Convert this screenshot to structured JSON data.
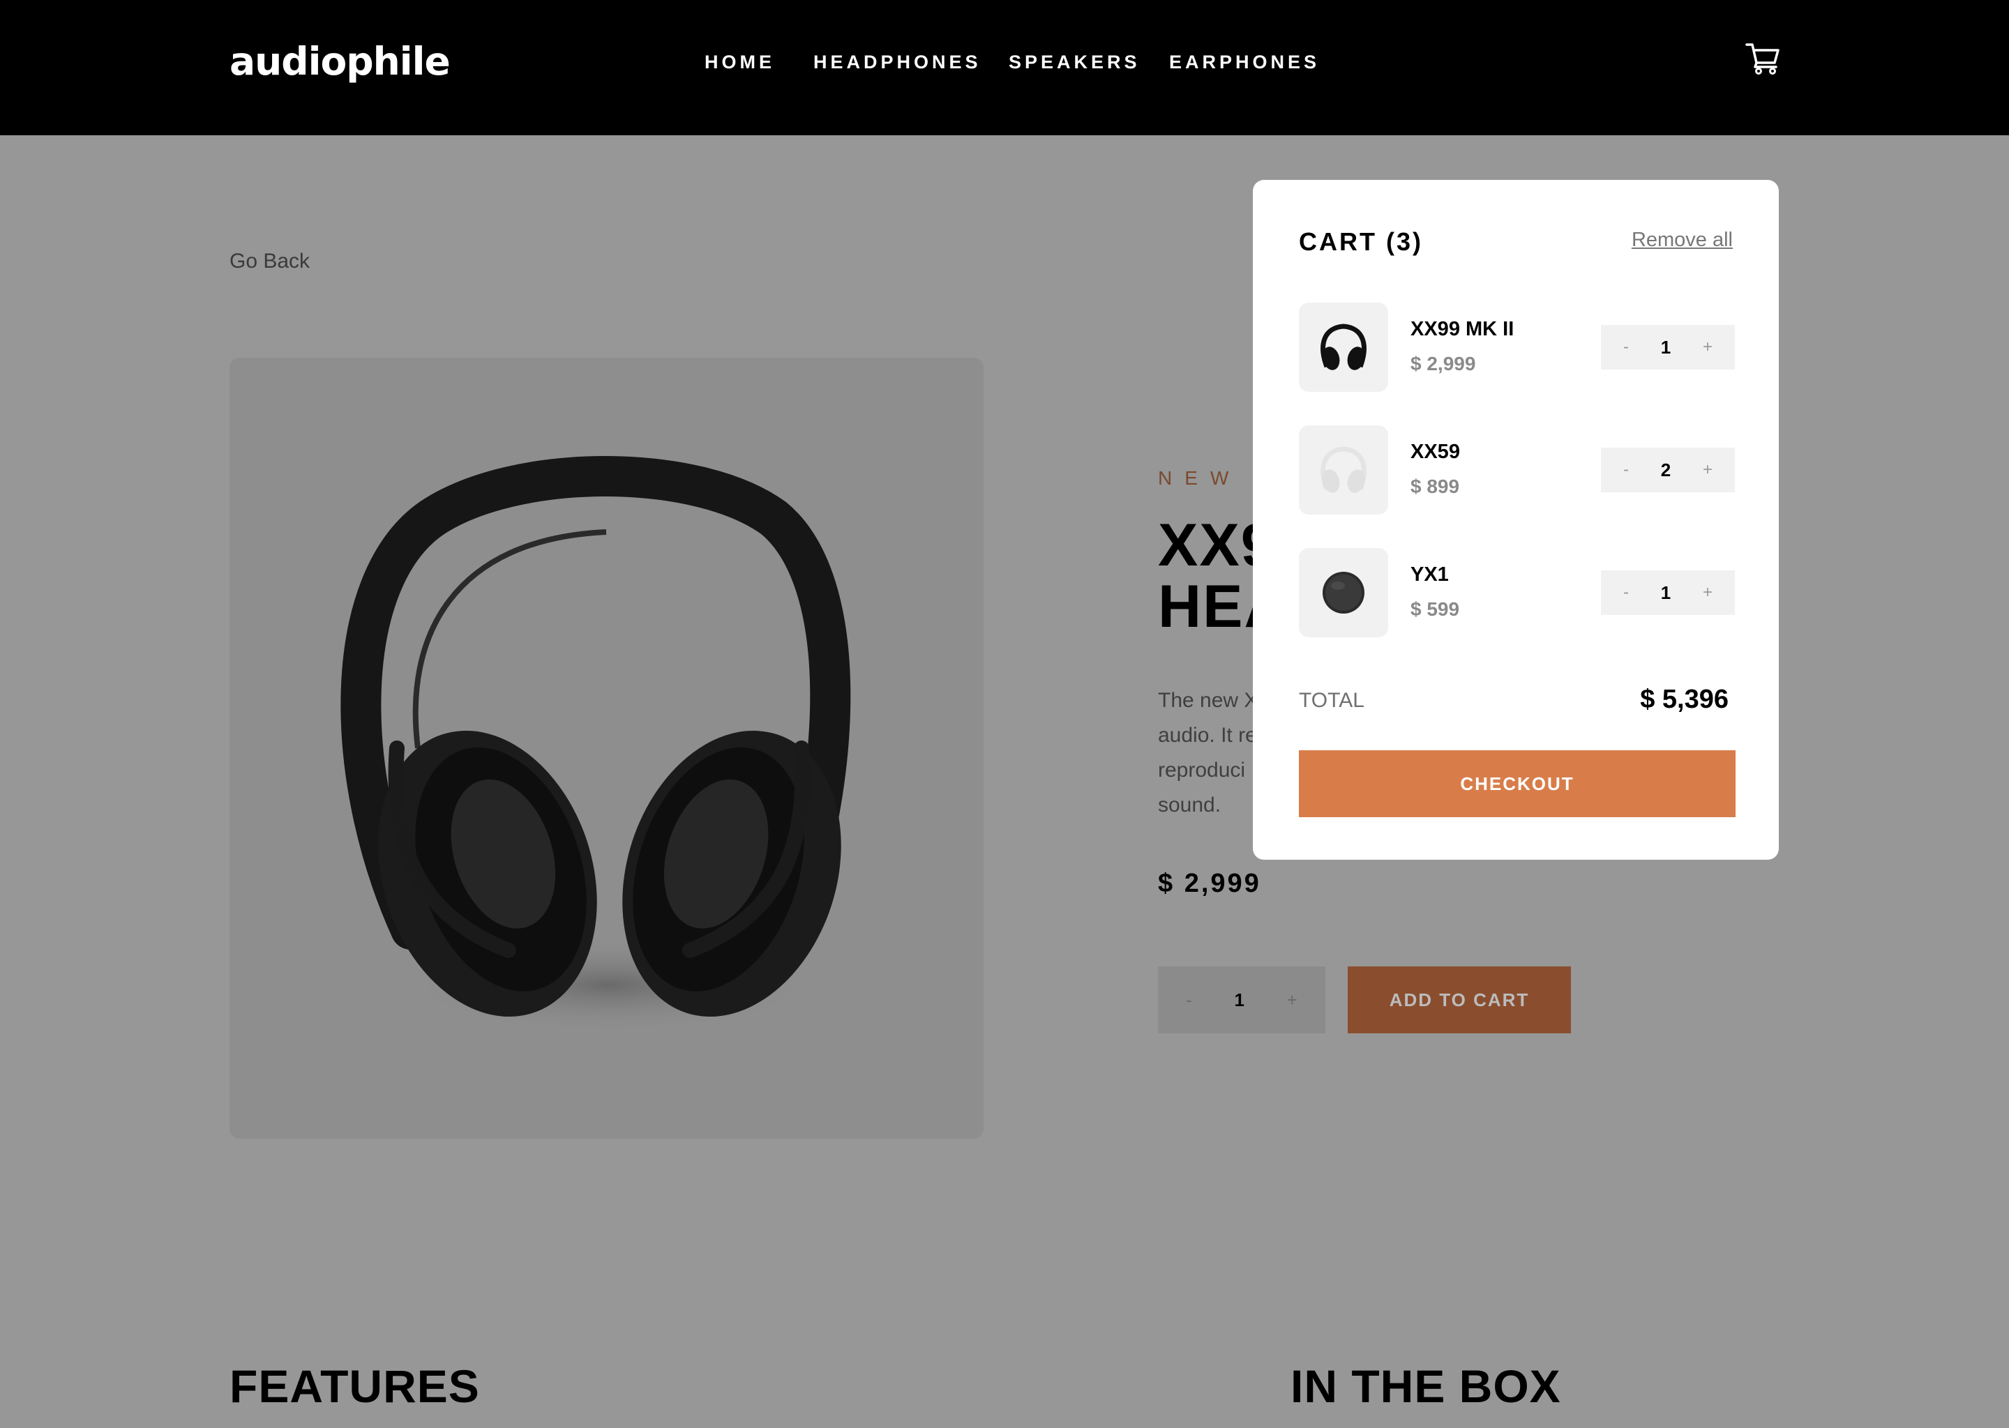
{
  "header": {
    "logo": "audiophile",
    "nav": [
      "HOME",
      "HEADPHONES",
      "SPEAKERS",
      "EARPHONES"
    ]
  },
  "page": {
    "go_back": "Go Back",
    "new_label": "NEW",
    "title_line1": "XX9",
    "title_line2": "HEA",
    "desc_lines": [
      "The new X",
      "audio. It re",
      "reproduci",
      "sound."
    ],
    "price": "$ 2,999",
    "quantity": "1",
    "add_to_cart": "ADD TO CART",
    "features_title": "FEATURES",
    "inthebox_title": "IN THE BOX"
  },
  "cart": {
    "heading": "CART (3)",
    "remove_all": "Remove all",
    "items": [
      {
        "name": "XX99 MK II",
        "price": "$ 2,999",
        "quantity": "1"
      },
      {
        "name": "XX59",
        "price": "$ 899",
        "quantity": "2"
      },
      {
        "name": "YX1",
        "price": "$ 599",
        "quantity": "1"
      }
    ],
    "total_label": "TOTAL",
    "total_value": "$ 5,396",
    "checkout": "CHECKOUT"
  },
  "stepper": {
    "minus": "-",
    "plus": "+"
  },
  "colors": {
    "accent": "#D87D4A",
    "header_bg": "#000000",
    "overlay_bg": "#979797"
  },
  "icons": {
    "cart": "cart-icon",
    "product": "headphones-icon"
  }
}
